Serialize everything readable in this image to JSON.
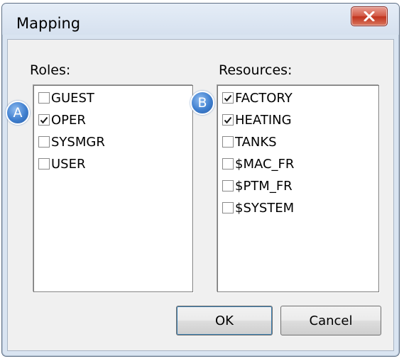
{
  "window": {
    "title": "Mapping",
    "close_icon": "close-x-icon"
  },
  "roles": {
    "label": "Roles:",
    "items": [
      {
        "label": "GUEST",
        "checked": false
      },
      {
        "label": "OPER",
        "checked": true
      },
      {
        "label": "SYSMGR",
        "checked": false
      },
      {
        "label": "USER",
        "checked": false
      }
    ]
  },
  "resources": {
    "label": "Resources:",
    "items": [
      {
        "label": "FACTORY",
        "checked": true
      },
      {
        "label": "HEATING",
        "checked": true
      },
      {
        "label": "TANKS",
        "checked": false
      },
      {
        "label": "$MAC_FR",
        "checked": false
      },
      {
        "label": "$PTM_FR",
        "checked": false
      },
      {
        "label": "$SYSTEM",
        "checked": false
      }
    ]
  },
  "markers": {
    "a": "A",
    "b": "B"
  },
  "buttons": {
    "ok": "OK",
    "cancel": "Cancel"
  },
  "colors": {
    "marker": "#3f7fcf",
    "close_button": "#c0321d"
  }
}
